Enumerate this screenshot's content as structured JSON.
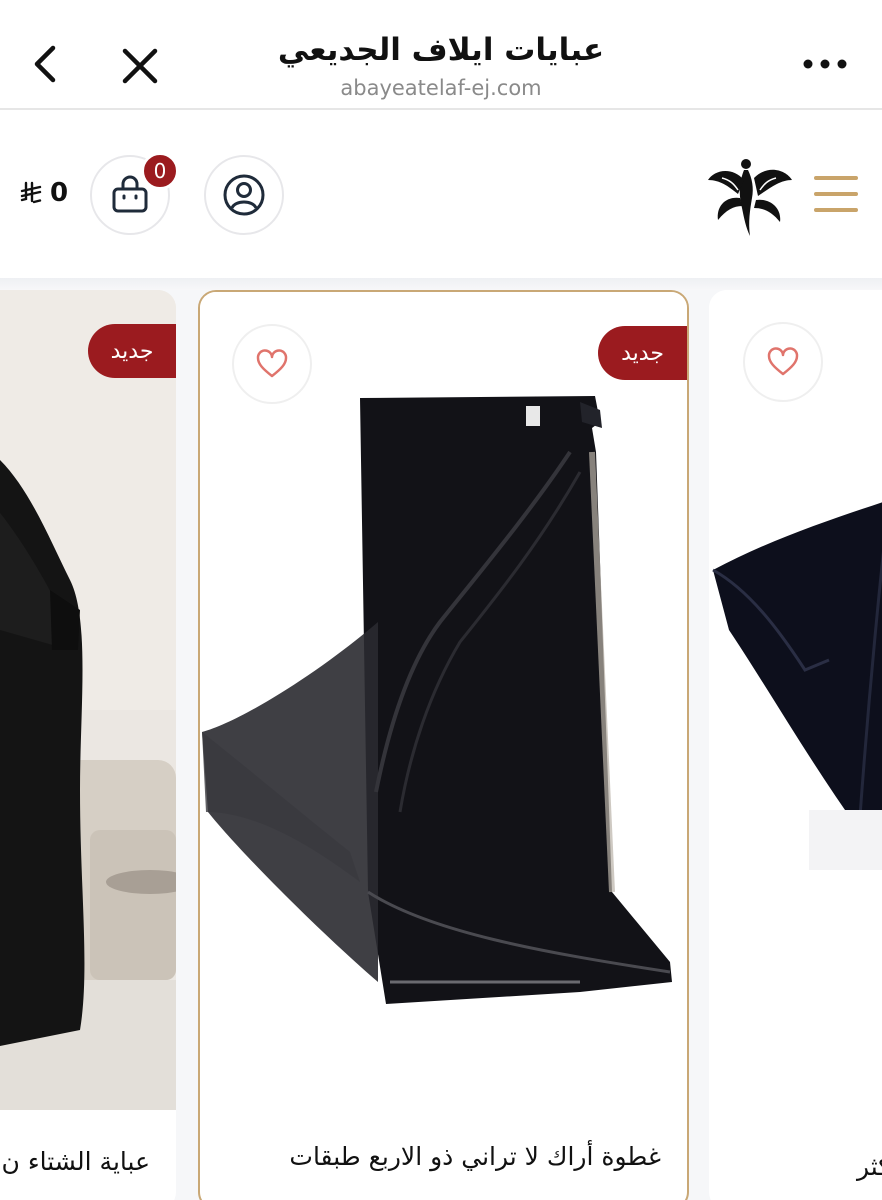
{
  "browser": {
    "title": "عبايات ايلاف الجديعي",
    "url": "abayeatelaf-ej.com",
    "back_icon": "chevron-left-icon",
    "close_icon": "close-icon",
    "more_icon": "more-dots-icon"
  },
  "store_header": {
    "cart_count": "0",
    "cart_total": "0",
    "currency_icon": "riyal-symbol-icon",
    "accent_color": "#9b1b1f",
    "menu_color": "#c9a46a"
  },
  "products": [
    {
      "badge": "جديد",
      "name": "عباية الشتاء ن"
    },
    {
      "badge": "جديد",
      "name": "غطوة أراك لا تراني ذو الاربع طبقات"
    },
    {
      "badge": "",
      "name": "كثر"
    }
  ]
}
